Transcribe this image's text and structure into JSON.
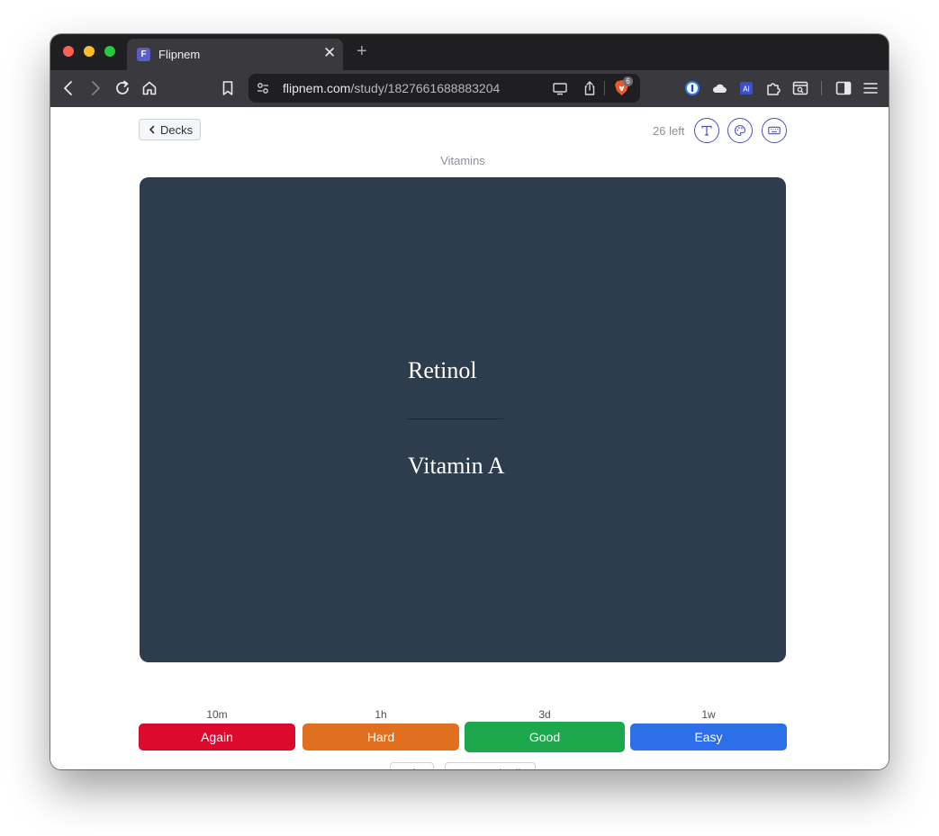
{
  "browser": {
    "tab_title": "Flipnem",
    "tab_favicon_letter": "F",
    "url_host": "flipnem.com",
    "url_path": "/study/1827661688883204",
    "shields_count": "6",
    "new_tab_symbol": "+",
    "close_symbol": "✕"
  },
  "header": {
    "back_label": "Decks",
    "cards_left": "26 left"
  },
  "deck": {
    "name": "Vitamins"
  },
  "card": {
    "front": "Retinol",
    "back": "Vitamin A",
    "background_color": "#2e3d4d"
  },
  "ratings": [
    {
      "label": "Again",
      "interval": "10m",
      "color": "#dc0a2d"
    },
    {
      "label": "Hard",
      "interval": "1h",
      "color": "#e07020"
    },
    {
      "label": "Good",
      "interval": "3d",
      "color": "#1ea84e"
    },
    {
      "label": "Easy",
      "interval": "1w",
      "color": "#2c6fe8"
    }
  ],
  "footer": {
    "info_label": "Info",
    "inspect_label": "Inspect / Edit"
  },
  "colors": {
    "accent": "#4b4fbd"
  }
}
